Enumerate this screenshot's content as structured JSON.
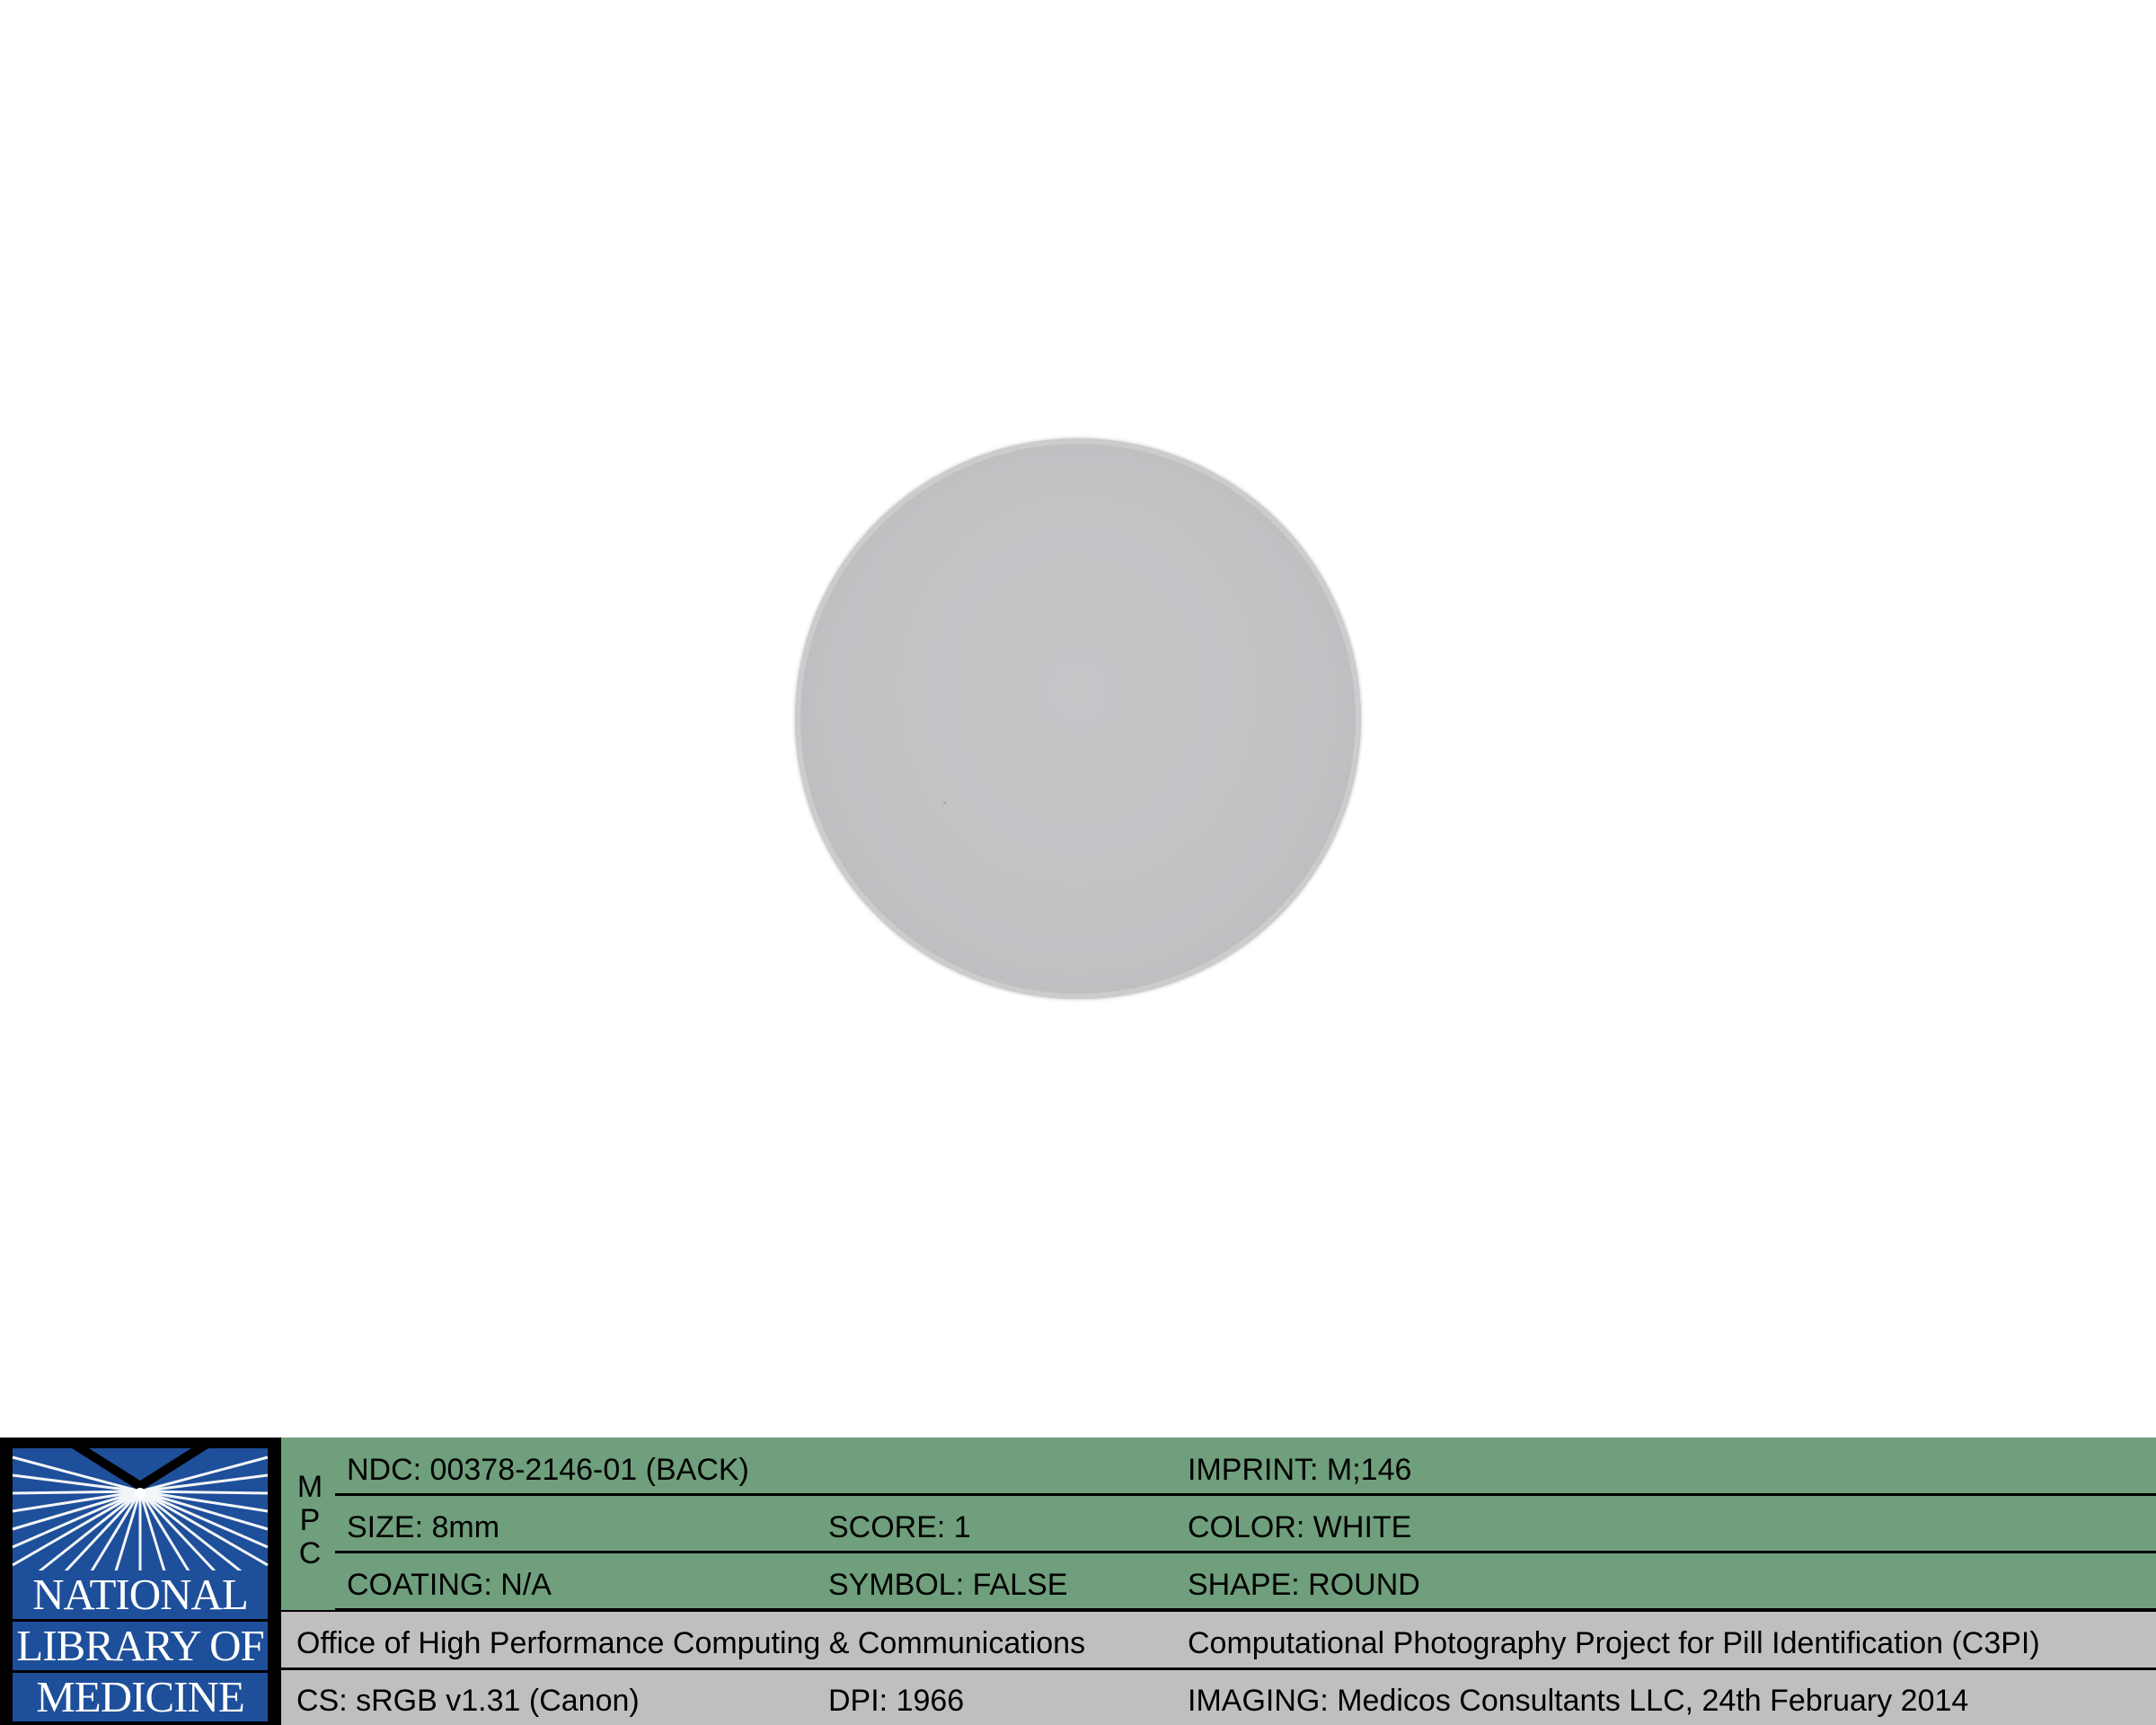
{
  "logo": {
    "line1": "NATIONAL",
    "line2": "LIBRARY OF",
    "line3": "MEDICINE"
  },
  "mpc": [
    "M",
    "P",
    "C"
  ],
  "rows": {
    "ndc": "NDC: 00378-2146-01 (BACK)",
    "imprint": "IMPRINT: M;146",
    "size": "SIZE: 8mm",
    "score": "SCORE: 1",
    "color": "COLOR: WHITE",
    "coating": "COATING: N/A",
    "symbol": "SYMBOL: FALSE",
    "shape": "SHAPE: ROUND",
    "office": "Office of High Performance Computing & Communications",
    "project": "Computational Photography Project for Pill Identification (C3PI)",
    "cs": "CS: sRGB v1.31 (Canon)",
    "dpi": "DPI: 1966",
    "imaging": "IMAGING: Medicos Consultants LLC, 24th February 2014"
  },
  "colors": {
    "panel_green": "#6f9f7c",
    "panel_gray": "#bfbfbf",
    "logo_blue": "#1e4f9a",
    "pill": "#c2c1c4"
  }
}
